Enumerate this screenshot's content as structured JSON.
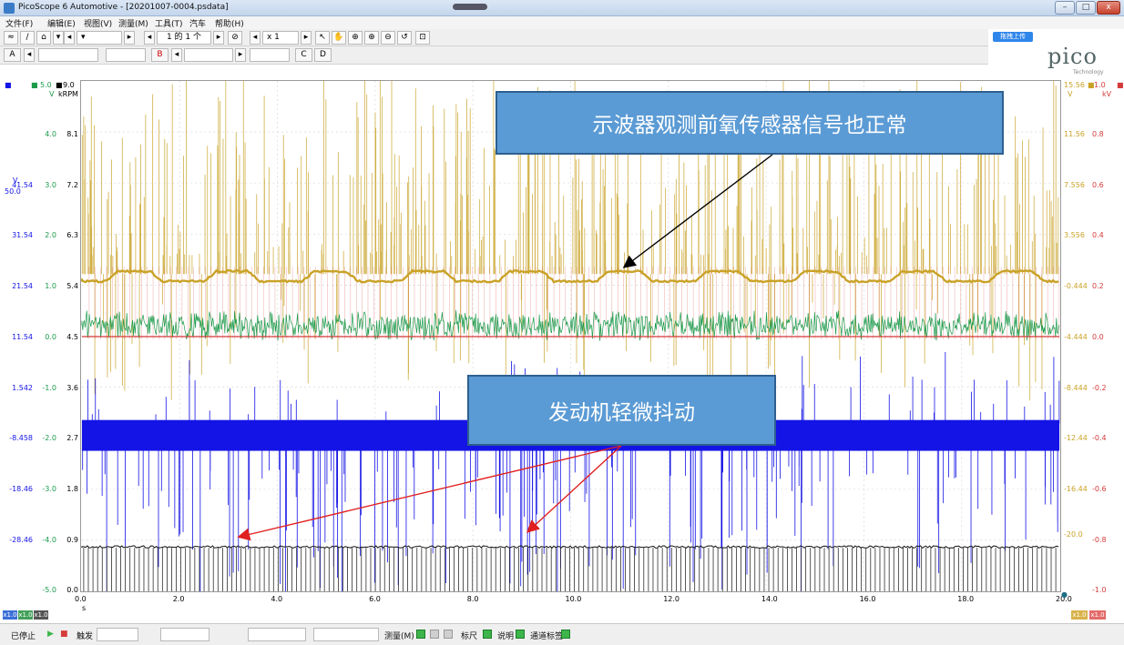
{
  "window": {
    "title": "PicoScope 6 Automotive - [20201007-0004.psdata]",
    "controls": {
      "minimize": "–",
      "maximize": "□",
      "close": "x"
    }
  },
  "menu": [
    "文件(F)",
    "编辑(E)",
    "视图(V)",
    "测量(M)",
    "工具(T)",
    "汽车",
    "帮助(H)"
  ],
  "toolbar1": {
    "buffer_label": "1 的 1 个",
    "zoom": "x 1"
  },
  "toolbar2": {
    "channels": [
      "A",
      "B",
      "C",
      "D"
    ]
  },
  "upload": {
    "label": "拖拽上传"
  },
  "brand": {
    "logo": "pico",
    "tagline": "Technology"
  },
  "axes": {
    "left_v": {
      "unit_top": "V",
      "top_label": "50.0",
      "ticks": [
        "41.54",
        "31.54",
        "21.54",
        "11.54",
        "1.542",
        "-8.458",
        "-18.46",
        "-28.46"
      ]
    },
    "left_green": {
      "top": "5.0",
      "unit": "V",
      "ticks": [
        "4.0",
        "3.0",
        "2.0",
        "1.0",
        "0.0",
        "-1.0",
        "-2.0",
        "-3.0",
        "-4.0",
        "-5.0"
      ]
    },
    "left_krpm": {
      "top": "9.0",
      "unit": "kRPM",
      "ticks": [
        "8.1",
        "7.2",
        "6.3",
        "5.4",
        "4.5",
        "3.6",
        "2.7",
        "1.8",
        "0.9",
        "0.0"
      ]
    },
    "right_gold": {
      "top": "15.56",
      "unit": "V",
      "ticks": [
        "11.56",
        "7.556",
        "3.556",
        "-0.444",
        "-4.444",
        "-8.444",
        "-12.44",
        "-16.44",
        "-20.0"
      ]
    },
    "right_kv": {
      "top": "1.0",
      "unit": "kV",
      "ticks": [
        "0.8",
        "0.6",
        "0.4",
        "0.2",
        "0.0",
        "-0.2",
        "-0.4",
        "-0.6",
        "-0.8",
        "-1.0"
      ]
    },
    "x": {
      "unit": "s",
      "ticks": [
        "0.0",
        "2.0",
        "4.0",
        "6.0",
        "8.0",
        "10.0",
        "12.0",
        "14.0",
        "16.0",
        "18.0",
        "20.0"
      ]
    }
  },
  "annotations": {
    "callout_top": "示波器观测前氧传感器信号也正常",
    "callout_mid": "发动机轻微抖动"
  },
  "chan_tags": [
    "x1.0",
    "x1.0",
    "x1.0",
    "x1.0",
    "x1.0"
  ],
  "status": {
    "state": "已停止",
    "trigger": "触发",
    "measure": "测量(M)",
    "ruler": "标尺",
    "notes": "说明",
    "channel_labels": "通道标签"
  },
  "colors": {
    "gold": "#c9a227",
    "green": "#1a9a4a",
    "blue": "#1414e6",
    "black": "#111111",
    "red": "#d63b3b",
    "callout_fill": "#5b9bd5"
  }
}
